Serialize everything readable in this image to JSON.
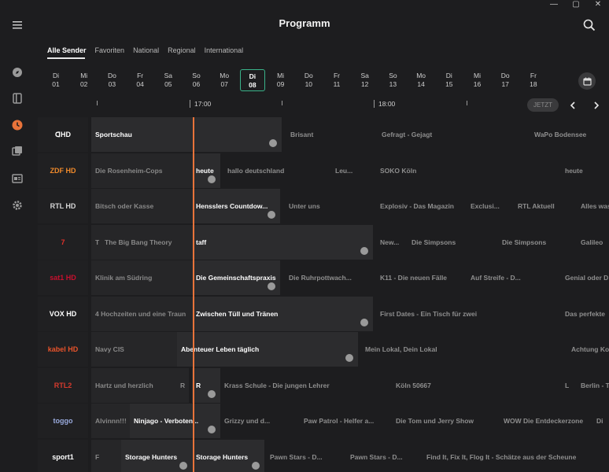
{
  "header": {
    "title": "Programm"
  },
  "window_controls": [
    "—",
    "▢",
    "✕"
  ],
  "rail": {
    "icons": [
      "menu-icon",
      "explore-icon",
      "library-icon",
      "clock-icon",
      "recordings-icon",
      "guide-icon",
      "settings-icon"
    ],
    "active": "clock-icon",
    "accent": "#e8733a"
  },
  "tabs": [
    {
      "label": "Alle Sender",
      "active": true
    },
    {
      "label": "Favoriten",
      "active": false
    },
    {
      "label": "National",
      "active": false
    },
    {
      "label": "Regional",
      "active": false
    },
    {
      "label": "International",
      "active": false
    }
  ],
  "dates": [
    {
      "day": "Di",
      "num": "01"
    },
    {
      "day": "Mi",
      "num": "02"
    },
    {
      "day": "Do",
      "num": "03"
    },
    {
      "day": "Fr",
      "num": "04"
    },
    {
      "day": "Sa",
      "num": "05"
    },
    {
      "day": "So",
      "num": "06"
    },
    {
      "day": "Mo",
      "num": "07"
    },
    {
      "day": "Di",
      "num": "08",
      "selected": true
    },
    {
      "day": "Mi",
      "num": "09"
    },
    {
      "day": "Do",
      "num": "10"
    },
    {
      "day": "Fr",
      "num": "11"
    },
    {
      "day": "Sa",
      "num": "12"
    },
    {
      "day": "So",
      "num": "13"
    },
    {
      "day": "Mo",
      "num": "14"
    },
    {
      "day": "Di",
      "num": "15"
    },
    {
      "day": "Mi",
      "num": "16"
    },
    {
      "day": "Do",
      "num": "17"
    },
    {
      "day": "Fr",
      "num": "18"
    }
  ],
  "timeline": {
    "labels": [
      "17:00",
      "18:00"
    ],
    "jetzt": "JETZT"
  },
  "channels": [
    {
      "logo": "ᗡHD",
      "programs": [
        {
          "title": "Sportschau",
          "cur": true
        },
        {
          "title": "Brisant"
        },
        {
          "title": "Gefragt - Gejagt"
        },
        {
          "title": "WaPo Bodensee"
        }
      ]
    },
    {
      "logo": "ZDF HD",
      "programs": [
        {
          "title": "Die Rosenheim-Cops"
        },
        {
          "title": "heute",
          "cur": true
        },
        {
          "title": "hallo deutschland"
        },
        {
          "title": "Leu..."
        },
        {
          "title": "SOKO Köln"
        },
        {
          "title": "heute"
        }
      ]
    },
    {
      "logo": "RTL HD",
      "programs": [
        {
          "title": "Bitsch oder Kasse"
        },
        {
          "title": "Hensslers Countdow...",
          "cur": true
        },
        {
          "title": "Unter uns"
        },
        {
          "title": "Explosiv - Das Magazin"
        },
        {
          "title": "Exclusi..."
        },
        {
          "title": "RTL Aktuell"
        },
        {
          "title": "Alles was"
        }
      ]
    },
    {
      "logo": "7",
      "programs": [
        {
          "title": "T"
        },
        {
          "title": "The Big Bang Theory"
        },
        {
          "title": "taff",
          "cur": true
        },
        {
          "title": "New..."
        },
        {
          "title": "Die Simpsons"
        },
        {
          "title": "Die Simpsons"
        },
        {
          "title": "Galileo"
        }
      ]
    },
    {
      "logo": "sat1 HD",
      "programs": [
        {
          "title": "Klinik am Südring"
        },
        {
          "title": "Die Gemeinschaftspraxis",
          "cur": true
        },
        {
          "title": "Die Ruhrpottwach..."
        },
        {
          "title": "K11 - Die neuen Fälle"
        },
        {
          "title": "Auf Streife - D..."
        },
        {
          "title": "Genial oder D"
        }
      ]
    },
    {
      "logo": "VOX HD",
      "programs": [
        {
          "title": "4 Hochzeiten und eine Traun"
        },
        {
          "title": "Zwischen Tüll und Tränen",
          "cur": true
        },
        {
          "title": "First Dates - Ein Tisch für zwei"
        },
        {
          "title": "Das perfekte"
        }
      ]
    },
    {
      "logo": "kabel HD",
      "programs": [
        {
          "title": "Navy CIS"
        },
        {
          "title": "Abenteuer Leben täglich",
          "cur": true
        },
        {
          "title": "Mein Lokal, Dein Lokal"
        },
        {
          "title": "Achtung Kontrolle"
        }
      ]
    },
    {
      "logo": "RTL2",
      "programs": [
        {
          "title": "Hartz und herzlich"
        },
        {
          "title": "R"
        },
        {
          "title": "R",
          "cur": true
        },
        {
          "title": "Krass Schule - Die jungen Lehrer"
        },
        {
          "title": "Köln 50667"
        },
        {
          "title": "L"
        },
        {
          "title": "Berlin - T"
        }
      ]
    },
    {
      "logo": "toggo",
      "programs": [
        {
          "title": "Alvinnn!!!"
        },
        {
          "title": "Ninjago - Verboten...",
          "cur": true
        },
        {
          "title": "Grizzy und d..."
        },
        {
          "title": "Paw Patrol - Helfer a..."
        },
        {
          "title": "Die Tom und Jerry Show"
        },
        {
          "title": "WOW Die Entdeckerzone"
        },
        {
          "title": "Di"
        }
      ]
    },
    {
      "logo": "sport1",
      "programs": [
        {
          "title": "F"
        },
        {
          "title": "Storage Hunters",
          "cur": true
        },
        {
          "title": "Storage Hunters",
          "cur": true
        },
        {
          "title": "Pawn Stars - D..."
        },
        {
          "title": "Pawn Stars - D..."
        },
        {
          "title": "Find It, Fix It, Flog It - Schätze aus der Scheune"
        }
      ]
    }
  ]
}
